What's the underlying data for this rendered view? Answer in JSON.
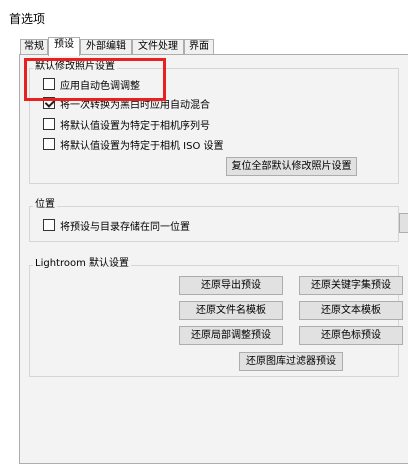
{
  "window": {
    "title": "首选项"
  },
  "tabs": [
    {
      "label": "常规"
    },
    {
      "label": "预设"
    },
    {
      "label": "外部编辑"
    },
    {
      "label": "文件处理"
    },
    {
      "label": "界面"
    }
  ],
  "default_develop": {
    "title": "默认修改照片设置",
    "checks": [
      {
        "label": "应用自动色调调整",
        "checked": false
      },
      {
        "label": "将一次转换为黑白时应用自动混合",
        "checked": true
      },
      {
        "label": "将默认值设置为特定于相机序列号",
        "checked": false
      },
      {
        "label": "将默认值设置为特定于相机 ISO 设置",
        "checked": false
      }
    ],
    "reset_button": "复位全部默认修改照片设置"
  },
  "location": {
    "title": "位置",
    "check": {
      "label": "将预设与目录存储在同一位置",
      "checked": false
    }
  },
  "lightroom_defaults": {
    "title": "Lightroom 默认设置",
    "buttons": [
      "还原导出预设",
      "还原关键字集预设",
      "还原文件名模板",
      "还原文本模板",
      "还原局部调整预设",
      "还原色标预设",
      "还原图库过滤器预设"
    ]
  }
}
